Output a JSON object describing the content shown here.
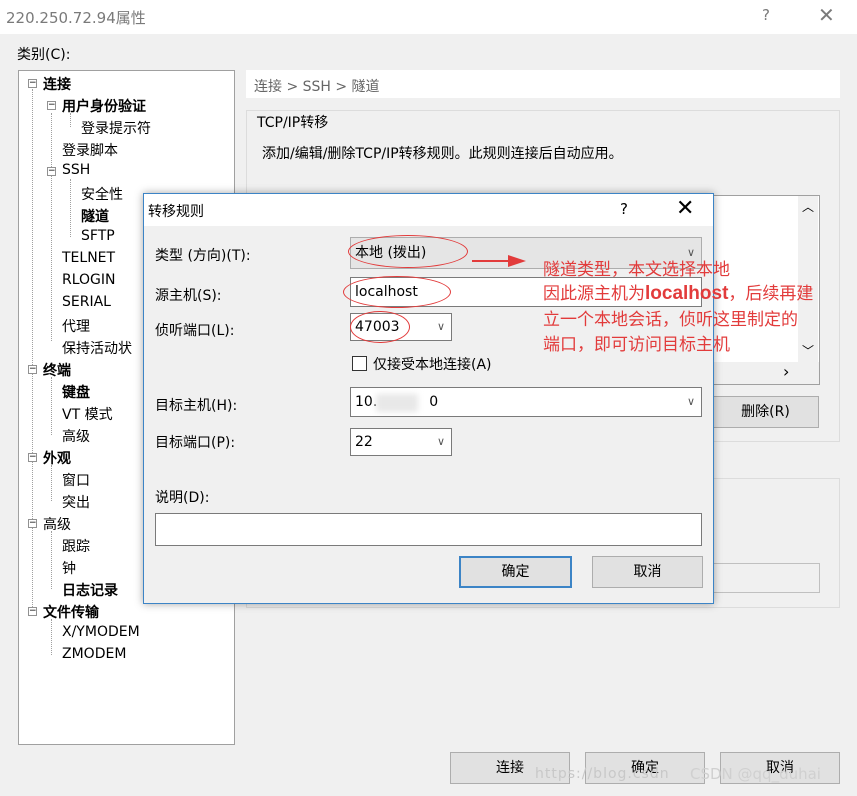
{
  "window": {
    "title": "220.250.72.94属性",
    "help_icon": "?",
    "close_icon": "✕"
  },
  "category_label": "类别(C):",
  "tree": {
    "connection": "连接",
    "auth": "用户身份验证",
    "login_prompt": "登录提示符",
    "login_script": "登录脚本",
    "ssh": "SSH",
    "security": "安全性",
    "tunnel": "隧道",
    "sftp": "SFTP",
    "telnet": "TELNET",
    "rlogin": "RLOGIN",
    "serial": "SERIAL",
    "proxy": "代理",
    "keepalive": "保持活动状",
    "terminal": "终端",
    "keyboard": "键盘",
    "vt_mode": "VT 模式",
    "advanced": "高级",
    "appearance": "外观",
    "window": "窗口",
    "highlight": "突出",
    "advanced2": "高级",
    "trace": "跟踪",
    "bell": "钟",
    "logging": "日志记录",
    "file_transfer": "文件传输",
    "xymodem": "X/YMODEM",
    "zmodem": "ZMODEM",
    "minus": "−",
    "plus": "+"
  },
  "breadcrumb": "连接 > SSH > 隧道",
  "tcp_section": {
    "title": "TCP/IP转移",
    "description": "添加/编辑/删除TCP/IP转移规则。此规则连接后自动应用。",
    "delete_label": "删除(R)",
    "scroll_up": "︿",
    "scroll_down": "﹀",
    "scroll_right": "›"
  },
  "footer": {
    "connect": "连接",
    "ok": "确定",
    "cancel": "取消"
  },
  "watermark": {
    "left": "https://blog.csdn",
    "right": "CSDN @qq_duhai"
  },
  "dialog": {
    "title": "转移规则",
    "help_icon": "?",
    "close_icon": "✕",
    "type_label": "类型 (方向)(T):",
    "type_value": "本地 (拨出)",
    "source_label": "源主机(S):",
    "source_value": "localhost",
    "listen_label": "侦听端口(L):",
    "listen_value": "47003",
    "local_only_label": "仅接受本地连接(A)",
    "dest_host_label": "目标主机(H):",
    "dest_host_prefix": "10.",
    "dest_host_suffix": "0",
    "dest_port_label": "目标端口(P):",
    "dest_port_value": "22",
    "desc_label": "说明(D):",
    "ok": "确定",
    "cancel": "取消",
    "chevron": "∨"
  },
  "annotation": {
    "line1": "隧道类型，本文选择本地",
    "line2_a": "因此源主机为",
    "line2_b": "localhost",
    "line2_c": "，后续再建",
    "line3": "立一个本地会话，侦听这里制定的",
    "line4": "端口，即可访问目标主机",
    "color": "#e23b3b"
  }
}
